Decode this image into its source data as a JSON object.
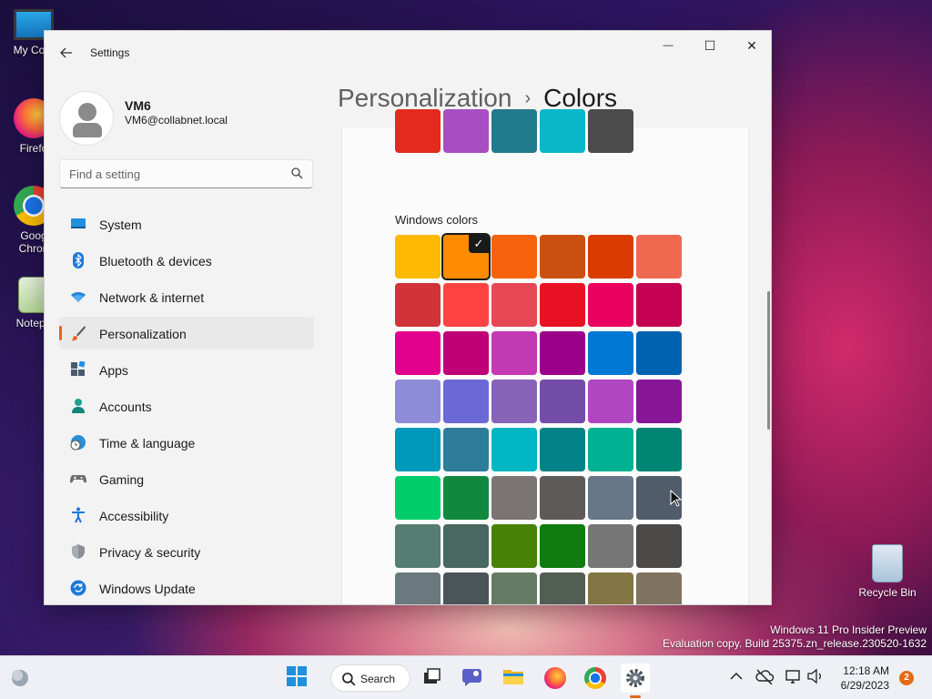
{
  "desktop": {
    "icons": [
      {
        "label": "My Com"
      },
      {
        "label": "Firefo"
      },
      {
        "label": "Goog\nChron"
      },
      {
        "label": "Notepa"
      },
      {
        "label": "Recycle Bin"
      }
    ],
    "watermark_line1": "Windows 11 Pro Insider Preview",
    "watermark_line2": "Evaluation copy. Build 25375.zn_release.230520-1632"
  },
  "window": {
    "app_title": "Settings",
    "controls": {
      "minimize": "—",
      "maximize": "☐",
      "close": "✕"
    }
  },
  "profile": {
    "name": "VM6",
    "email": "VM6@collabnet.local"
  },
  "search": {
    "placeholder": "Find a setting"
  },
  "nav": {
    "items": [
      {
        "label": "System",
        "icon": "system-icon"
      },
      {
        "label": "Bluetooth & devices",
        "icon": "bluetooth-icon"
      },
      {
        "label": "Network & internet",
        "icon": "wifi-icon"
      },
      {
        "label": "Personalization",
        "icon": "brush-icon",
        "selected": true
      },
      {
        "label": "Apps",
        "icon": "apps-icon"
      },
      {
        "label": "Accounts",
        "icon": "accounts-icon"
      },
      {
        "label": "Time & language",
        "icon": "globe-clock-icon"
      },
      {
        "label": "Gaming",
        "icon": "gamepad-icon"
      },
      {
        "label": "Accessibility",
        "icon": "accessibility-icon"
      },
      {
        "label": "Privacy & security",
        "icon": "shield-icon"
      },
      {
        "label": "Windows Update",
        "icon": "update-icon"
      }
    ]
  },
  "breadcrumb": {
    "parent": "Personalization",
    "separator": "›",
    "current": "Colors"
  },
  "colors": {
    "recent_row": [
      "#e22b1e",
      "#a74ec2",
      "#227b8c",
      "#0ab8c8",
      "#4b4b4b"
    ],
    "windows_colors_label": "Windows colors",
    "selected_index": 1,
    "check_mark": "✓",
    "grid": [
      [
        "#ffb900",
        "#ff8c00",
        "#f7630c",
        "#ca5010",
        "#da3b01",
        "#ef6950"
      ],
      [
        "#d13438",
        "#ff4343",
        "#e74856",
        "#e81123",
        "#ea005e",
        "#c30052"
      ],
      [
        "#e3008c",
        "#bf0077",
        "#c239b3",
        "#9a0089",
        "#0078d4",
        "#0063b1"
      ],
      [
        "#8e8cd8",
        "#6b69d6",
        "#8764b8",
        "#744da9",
        "#b146c2",
        "#881798"
      ],
      [
        "#0099bc",
        "#2d7d9a",
        "#00b7c3",
        "#038387",
        "#00b294",
        "#018574"
      ],
      [
        "#00cc6a",
        "#10893e",
        "#7a7574",
        "#5d5a58",
        "#68768a",
        "#515c6b"
      ],
      [
        "#567c73",
        "#486860",
        "#498205",
        "#107c10",
        "#767676",
        "#4c4a48"
      ],
      [
        "#69797e",
        "#4a5459",
        "#647c64",
        "#525e54",
        "#847545",
        "#7e735f"
      ]
    ]
  },
  "taskbar": {
    "search_label": "Search",
    "time": "12:18 AM",
    "date": "6/29/2023",
    "notification_count": "2"
  }
}
